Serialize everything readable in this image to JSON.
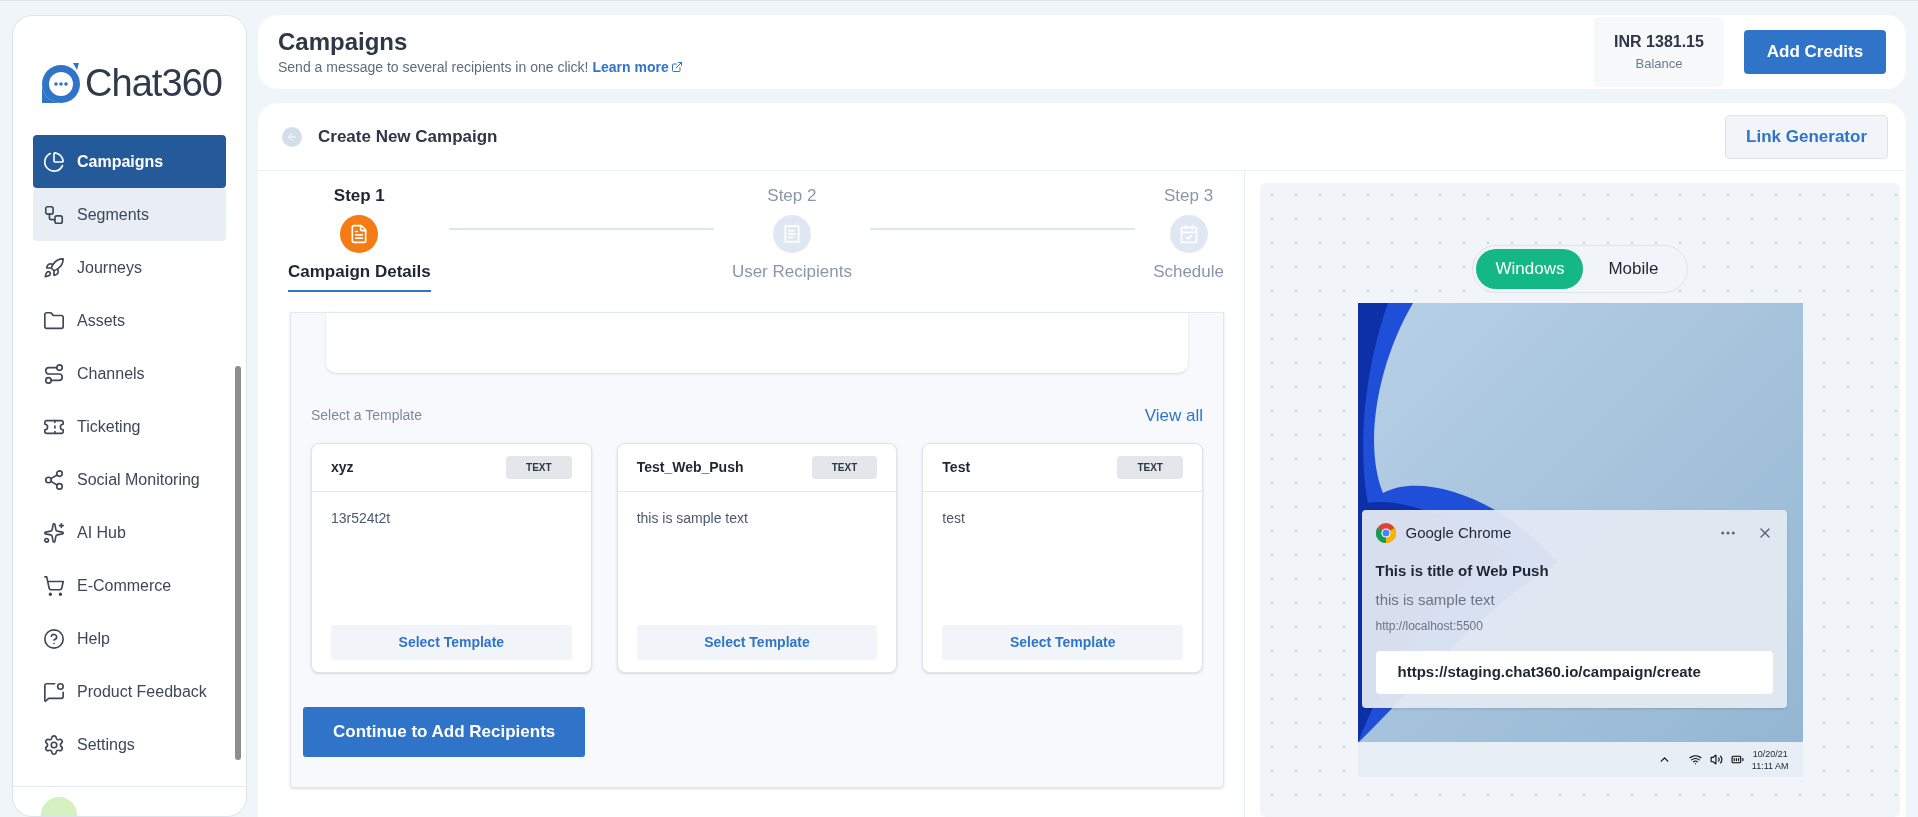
{
  "sidebar": {
    "logo": {
      "text": "Chat",
      "number": "360"
    },
    "items": [
      {
        "label": "Campaigns",
        "selected": true,
        "hovered": false
      },
      {
        "label": "Segments",
        "selected": false,
        "hovered": true
      },
      {
        "label": "Journeys",
        "selected": false,
        "hovered": false
      },
      {
        "label": "Assets",
        "selected": false,
        "hovered": false
      },
      {
        "label": "Channels",
        "selected": false,
        "hovered": false
      },
      {
        "label": "Ticketing",
        "selected": false,
        "hovered": false
      },
      {
        "label": "Social Monitoring",
        "selected": false,
        "hovered": false
      },
      {
        "label": "AI Hub",
        "selected": false,
        "hovered": false
      },
      {
        "label": "E-Commerce",
        "selected": false,
        "hovered": false
      },
      {
        "label": "Help",
        "selected": false,
        "hovered": false
      },
      {
        "label": "Product Feedback",
        "selected": false,
        "hovered": false
      },
      {
        "label": "Settings",
        "selected": false,
        "hovered": false
      }
    ]
  },
  "header": {
    "title": "Campaigns",
    "subtitle": "Send a message to several recipients in one click!",
    "link": "Learn more",
    "balance": {
      "amount": "INR 1381.15",
      "label": "Balance"
    },
    "button": "Add Credits"
  },
  "panel": {
    "title": "Create New Campaign",
    "button": "Link Generator",
    "steps": [
      {
        "step": "Step 1",
        "label": "Campaign Details",
        "selected": true
      },
      {
        "step": "Step 2",
        "label": "User Recipients",
        "selected": false
      },
      {
        "step": "Step 3",
        "label": "Schedule",
        "selected": false
      }
    ],
    "templates": {
      "label": "Select a Template",
      "view_all": "View all",
      "items": [
        {
          "name": "xyz",
          "badge": "TEXT",
          "body": "13r524t2t",
          "button": "Select Template"
        },
        {
          "name": "Test_Web_Push",
          "badge": "TEXT",
          "body": "this is sample text",
          "button": "Select Template"
        },
        {
          "name": "Test",
          "badge": "TEXT",
          "body": "test",
          "button": "Select Template"
        }
      ]
    },
    "continue_button": "Continue to Add Recipients"
  },
  "preview": {
    "tabs": [
      {
        "label": "Windows",
        "selected": true
      },
      {
        "label": "Mobile",
        "selected": false
      }
    ],
    "notification": {
      "app": "Google Chrome",
      "title": "This is title of Web Push",
      "body": "this is sample text",
      "origin": "http://localhost:5500",
      "action": "https://staging.chat360.io/campaign/create"
    },
    "taskbar": {
      "date": "10/20/21",
      "time": "11:11 AM"
    }
  }
}
